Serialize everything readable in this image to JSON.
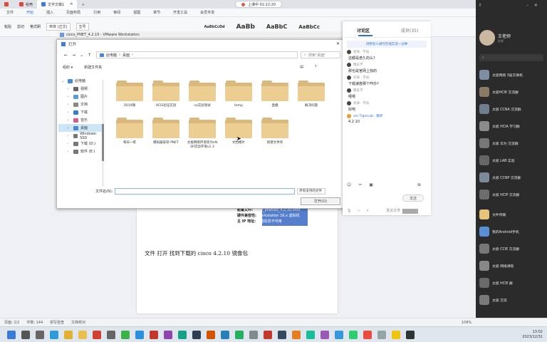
{
  "wps": {
    "tabs": [
      {
        "label": "稻壳"
      },
      {
        "label": "文字文稿1"
      }
    ],
    "record": {
      "label": "上课中 01:22:20"
    },
    "menu": [
      "文件",
      "开始",
      "插入",
      "页面布局",
      "引用",
      "审阅",
      "视图",
      "章节",
      "开发工具",
      "会员专享"
    ],
    "menu_active_index": 1,
    "ribbon": {
      "paste": "粘贴",
      "cut": "剪切",
      "format_painter": "格式刷",
      "font_name": "宋体 (正文)",
      "font_size": "五号",
      "styles": [
        "AaBbCcDd",
        "AaBb",
        "AaBbC",
        "AaBbCc"
      ]
    }
  },
  "document": {
    "caption": "文件 打开 找到下载的 cisco 4.2.10 镜像包",
    "config_lines": [
      {
        "label": "配置文件:",
        "value": "cisco_pnetlab_4.2.10.vmx"
      },
      {
        "label": "硬件兼容性:",
        "value": "Workstation 16.x 虚拟机"
      },
      {
        "label": "主 IP 地址:",
        "value": "网络信息不可用"
      }
    ]
  },
  "vmware": {
    "title": "cisco_PNET_4.2.10 - VMware Workstation"
  },
  "open_dialog": {
    "title": "打开",
    "address": [
      "此电脑",
      "桌面"
    ],
    "search_placeholder": "搜索\"桌面\"",
    "toolbar": {
      "organize": "组织 ▾",
      "new_folder": "新建文件夹"
    },
    "sidebar": [
      {
        "label": "此电脑",
        "expanded": true,
        "color": "#4a88d6"
      },
      {
        "label": "视频",
        "color": "#666"
      },
      {
        "label": "图片",
        "color": "#5b9bd5"
      },
      {
        "label": "文档",
        "color": "#888"
      },
      {
        "label": "下载",
        "color": "#3a7bd5"
      },
      {
        "label": "音乐",
        "color": "#d65a8a"
      },
      {
        "label": "桌面",
        "color": "#4a88d6",
        "selected": true
      },
      {
        "label": "Windows-SSD",
        "color": "#777"
      },
      {
        "label": "下载 (D:)",
        "color": "#777"
      },
      {
        "label": "软件 (E:)",
        "color": "#777"
      }
    ],
    "folders": [
      {
        "name": "0019期"
      },
      {
        "name": "HCIE验证实验"
      },
      {
        "name": "na实验测试"
      },
      {
        "name": "temp"
      },
      {
        "name": "直播"
      },
      {
        "name": "解决问题"
      },
      {
        "name": "每日一练"
      },
      {
        "name": "模拟器安装-PNET"
      },
      {
        "name": "太极网络环境等为eNSP实验环境v1.3"
      },
      {
        "name": "文档模片"
      },
      {
        "name": "新建文件夹"
      }
    ],
    "file_name_label": "文件名(N):",
    "file_name_value": "",
    "file_type": "所有支持的文件",
    "open_button": "打开(O)"
  },
  "discussion": {
    "tabs": [
      "讨论区",
      "成员(35)"
    ],
    "notice": "对所有人进行在线交流一分钟",
    "messages": [
      {
        "user": "刘洋 · 学员",
        "text": "这都是老久的么?"
      },
      {
        "user": "晓东学",
        "text": "那也是官网上找的"
      },
      {
        "user": "刘洋 · 学员",
        "text": "下载速度那个咋办?"
      },
      {
        "user": "晓东学",
        "text": "嘻嘻"
      },
      {
        "user": "刘洋 · 学员",
        "text": "好吧"
      },
      {
        "user": "xm TigerLab · 教师",
        "text": "4.2.10",
        "teacher": true
      }
    ],
    "send_label": "发送",
    "bottom_label": "发言文件"
  },
  "chat_list": {
    "profile": {
      "name": "王老师",
      "sub": "群聊"
    },
    "items": [
      {
        "name": "太极网络 3层交换机",
        "sub": "",
        "color": "#7d8fa3"
      },
      {
        "name": "太极HCIE 交流群",
        "sub": "",
        "color": "#8a7a66"
      },
      {
        "name": "太极 CCNA 交流群",
        "sub": "",
        "color": "#6f7d8c"
      },
      {
        "name": "太极 HCIA 学习群",
        "sub": "",
        "color": "#8c8c8c"
      },
      {
        "name": "太极 华为 交流群",
        "sub": "",
        "color": "#777"
      },
      {
        "name": "太极 LAB 实验",
        "sub": "",
        "color": "#666"
      },
      {
        "name": "太极 CCNP 交流群",
        "sub": "",
        "color": "#7a8a9a"
      },
      {
        "name": "太极 HCIP 交流群",
        "sub": "",
        "color": "#6d6d6d"
      },
      {
        "name": "文件传输",
        "sub": "",
        "color": "#e8c37a"
      },
      {
        "name": "我的Android手机",
        "sub": "",
        "color": "#5a8fd6"
      },
      {
        "name": "太极 CCIE 交流群",
        "sub": "",
        "color": "#777"
      },
      {
        "name": "太极 网络课程",
        "sub": "",
        "color": "#888"
      },
      {
        "name": "太极 HCIE 群",
        "sub": "",
        "color": "#6a6a6a"
      },
      {
        "name": "太极 交流",
        "sub": "",
        "color": "#7a7a7a"
      }
    ]
  },
  "status": {
    "page": "页面: 2/2",
    "words": "字数: 144",
    "spell": "拼写检查",
    "doc_check": "文档校对",
    "zoom": "108%"
  },
  "taskbar": {
    "time": "13:02",
    "date": "2023/12/31"
  }
}
